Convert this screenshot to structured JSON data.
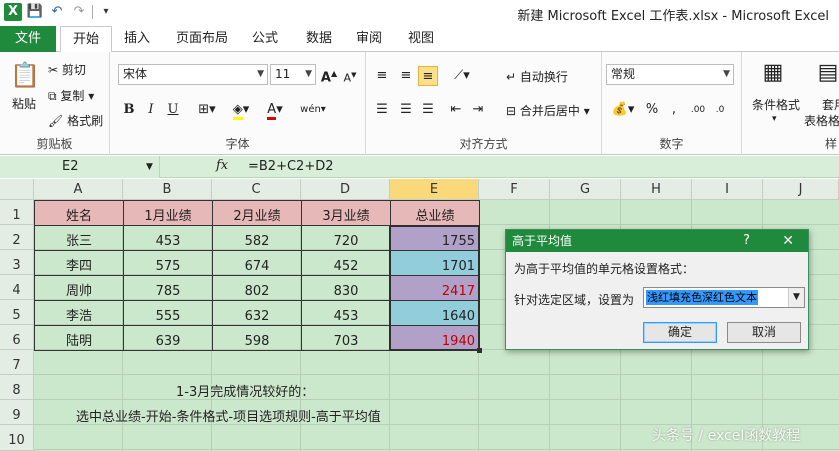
{
  "window": {
    "title": "新建 Microsoft Excel 工作表.xlsx - Microsoft Excel"
  },
  "tabs": [
    "文件",
    "开始",
    "插入",
    "页面布局",
    "公式",
    "数据",
    "审阅",
    "视图"
  ],
  "ribbon": {
    "clipboard": {
      "paste": "粘贴",
      "cut": "剪切",
      "copy": "复制",
      "format_painter": "格式刷",
      "label": "剪贴板"
    },
    "font": {
      "name": "宋体",
      "size": "11",
      "bold": "B",
      "italic": "I",
      "underline": "U",
      "label": "字体"
    },
    "align": {
      "wrap": "自动换行",
      "merge": "合并后居中",
      "label": "对齐方式"
    },
    "number": {
      "format": "常规",
      "label": "数字",
      "percent": "%"
    },
    "styles": {
      "conditional": "条件格式",
      "table": "套用",
      "table2": "表格格",
      "label": "样"
    }
  },
  "formula_bar": {
    "name_box": "E2",
    "fx": "fx",
    "formula": "=B2+C2+D2"
  },
  "columns": [
    "A",
    "B",
    "C",
    "D",
    "E",
    "F",
    "G",
    "H",
    "I",
    "J"
  ],
  "rows": [
    "1",
    "2",
    "3",
    "4",
    "5",
    "6",
    "7",
    "8",
    "9",
    "10"
  ],
  "table": {
    "headers": [
      "姓名",
      "1月业绩",
      "2月业绩",
      "3月业绩",
      "总业绩"
    ],
    "rows": [
      [
        "张三",
        "453",
        "582",
        "720",
        "1755"
      ],
      [
        "李四",
        "575",
        "674",
        "452",
        "1701"
      ],
      [
        "周帅",
        "785",
        "802",
        "830",
        "2417"
      ],
      [
        "李浩",
        "555",
        "632",
        "453",
        "1640"
      ],
      [
        "陆明",
        "639",
        "598",
        "703",
        "1940"
      ]
    ]
  },
  "notes": {
    "row8": "1-3月完成情况较好的：",
    "row9": "选中总业绩-开始-条件格式-项目选项规则-高于平均值"
  },
  "dialog": {
    "title": "高于平均值",
    "help": "?",
    "close": "✕",
    "description": "为高于平均值的单元格设置格式：",
    "label": "针对选定区域，设置为",
    "selected": "浅红填充色深红色文本",
    "ok": "确定",
    "cancel": "取消"
  },
  "watermark": "头条号 / excel函数教程",
  "colors": {
    "header_fill": "#e6b8b7",
    "highlight_blue": "#92cddc",
    "highlight_purple": "#b1a0c7",
    "text_red": "#c00000",
    "sheet_bg": "#cce8cc",
    "accent": "#1f8a3c"
  }
}
